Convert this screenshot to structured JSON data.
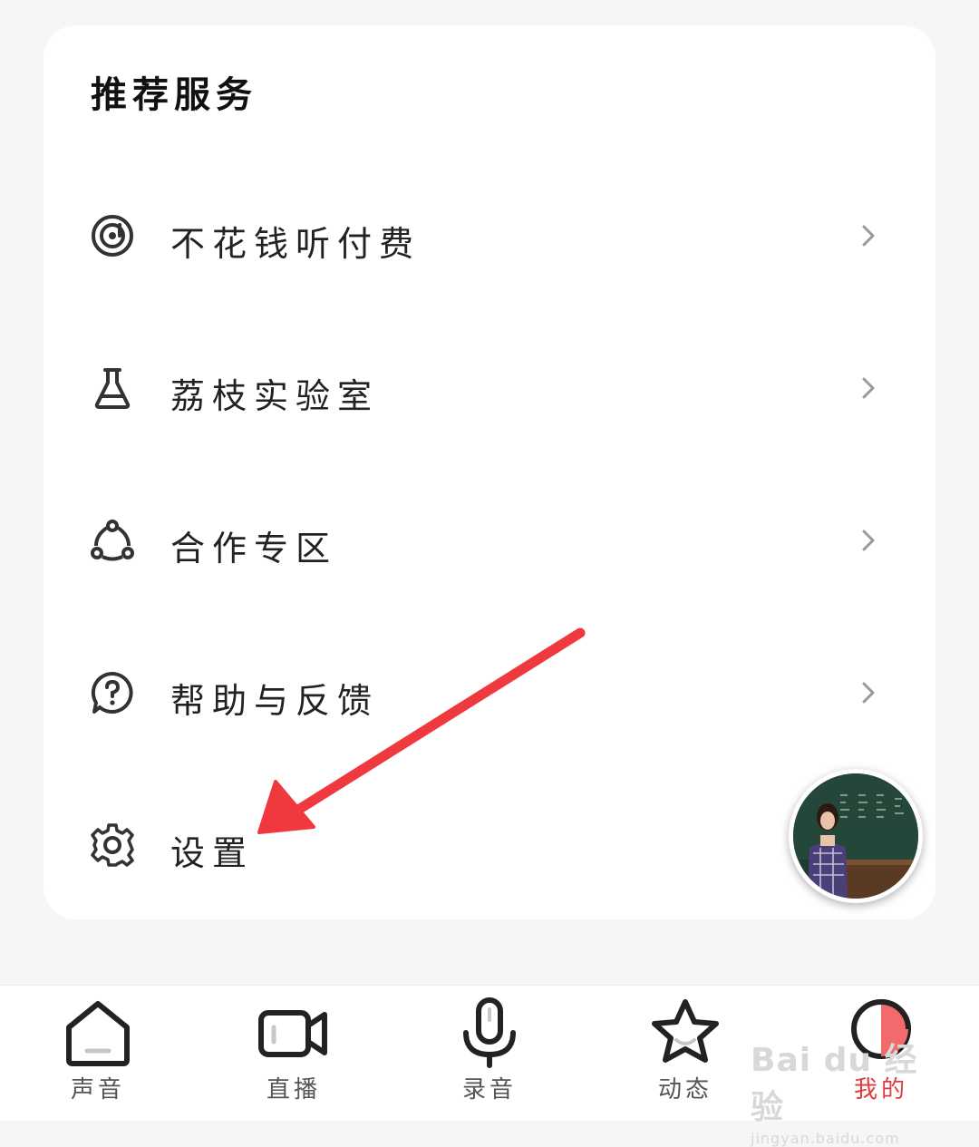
{
  "section": {
    "title": "推荐服务"
  },
  "menu": {
    "items": [
      {
        "label": "不花钱听付费",
        "icon": "music-disc-icon"
      },
      {
        "label": "荔枝实验室",
        "icon": "flask-icon"
      },
      {
        "label": "合作专区",
        "icon": "share-nodes-icon"
      },
      {
        "label": "帮助与反馈",
        "icon": "help-bubble-icon"
      },
      {
        "label": "设置",
        "icon": "gear-icon"
      }
    ]
  },
  "floating_video": {
    "icon": "video-thumbnail"
  },
  "annotation": {
    "color": "#f0393e",
    "target": "设置"
  },
  "tabbar": {
    "items": [
      {
        "label": "声音",
        "icon": "home-icon",
        "active": false
      },
      {
        "label": "直播",
        "icon": "video-camera-icon",
        "active": false
      },
      {
        "label": "录音",
        "icon": "microphone-icon",
        "active": false
      },
      {
        "label": "动态",
        "icon": "star-icon",
        "active": false
      },
      {
        "label": "我的",
        "icon": "profile-icon",
        "active": true
      }
    ],
    "active_color": "#e4393c"
  },
  "watermark": {
    "logo": "Bai du 经验",
    "url": "jingyan.baidu.com"
  }
}
